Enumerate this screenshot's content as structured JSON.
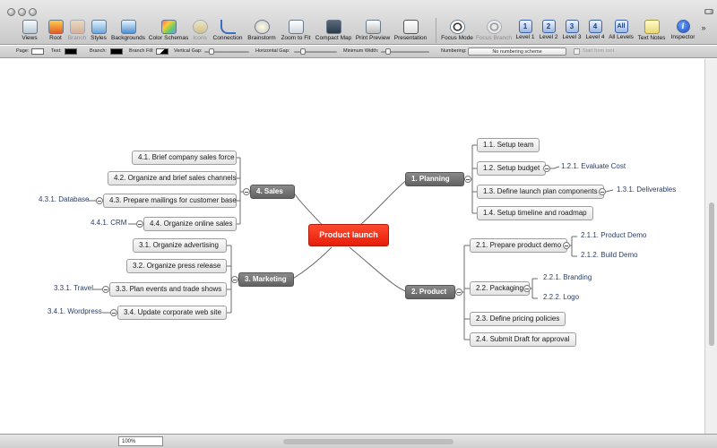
{
  "toolbar": {
    "items": [
      {
        "label": "Views",
        "icon": "views-icon"
      },
      {
        "label": "Root",
        "icon": "root-icon"
      },
      {
        "label": "Branch",
        "icon": "branch-icon",
        "disabled": true
      },
      {
        "label": "Styles",
        "icon": "styles-icon"
      },
      {
        "label": "Backgrounds",
        "icon": "backgrounds-icon"
      },
      {
        "label": "Color Schemas",
        "icon": "color-schemas-icon"
      },
      {
        "label": "Icons",
        "icon": "icons-icon",
        "disabled": true
      },
      {
        "label": "Connection",
        "icon": "connection-icon"
      },
      {
        "label": "Brainstorm",
        "icon": "brainstorm-icon"
      },
      {
        "label": "Zoom to Fit",
        "icon": "zoom-to-fit-icon"
      },
      {
        "label": "Compact Map",
        "icon": "compact-map-icon"
      },
      {
        "label": "Print Preview",
        "icon": "print-preview-icon"
      },
      {
        "label": "Presentation",
        "icon": "presentation-icon"
      },
      {
        "label": "Focus Mode",
        "icon": "focus-mode-icon"
      },
      {
        "label": "Focus Branch",
        "icon": "focus-branch-icon",
        "disabled": true
      },
      {
        "label": "Level 1",
        "icon": "level-1-icon",
        "glyph": "1"
      },
      {
        "label": "Level 2",
        "icon": "level-2-icon",
        "glyph": "2"
      },
      {
        "label": "Level 3",
        "icon": "level-3-icon",
        "glyph": "3"
      },
      {
        "label": "Level 4",
        "icon": "level-4-icon",
        "glyph": "4"
      },
      {
        "label": "All Levels",
        "icon": "all-levels-icon",
        "glyph": "All"
      },
      {
        "label": "Text Notes",
        "icon": "text-notes-icon"
      },
      {
        "label": "Inspector",
        "icon": "inspector-icon",
        "glyph": "i"
      }
    ],
    "overflow": "»"
  },
  "formatbar": {
    "page_label": "Page:",
    "text_label": "Text:",
    "branch_label": "Branch:",
    "branch_fill_label": "Branch Fill:",
    "vertical_gap_label": "Vertical Gap:",
    "horizontal_gap_label": "Horizontal Gap:",
    "minimum_width_label": "Minimum Width:",
    "numbering_label": "Numbering:",
    "numbering_value": "No numbering scheme",
    "start_from_root_label": "Start from root"
  },
  "map": {
    "central": "Product launch",
    "branches": {
      "planning": "1.    Planning",
      "product": "2.    Product",
      "marketing": "3.    Marketing",
      "sales": "4.    Sales"
    },
    "topics": {
      "t1_1": "1.1.   Setup team",
      "t1_2": "1.2.   Setup budget",
      "t1_3": "1.3.   Define launch plan components",
      "t1_4": "1.4.   Setup timeline and roadmap",
      "t2_1": "2.1.   Prepare product demo",
      "t2_2": "2.2.   Packaging",
      "t2_3": "2.3.   Define pricing policies",
      "t2_4": "2.4.   Submit Draft for approval",
      "t3_1": "3.1.   Organize advertising",
      "t3_2": "3.2.   Organize press release",
      "t3_3": "3.3.   Plan events and trade shows",
      "t3_4": "3.4.   Update corporate web site",
      "t4_1": "4.1.   Brief company sales force",
      "t4_2": "4.2.   Organize and brief sales channels",
      "t4_3": "4.3.   Prepare mailings for customer base",
      "t4_4": "4.4.   Organize online sales"
    },
    "subtopics": {
      "s1_2_1": "1.2.1.  Evaluate Cost",
      "s1_3_1": "1.3.1.  Deliverables",
      "s2_1_1": "2.1.1.  Product Demo",
      "s2_1_2": "2.1.2.  Build Demo",
      "s2_2_1": "2.2.1.  Branding",
      "s2_2_2": "2.2.2.  Logo",
      "s3_3_1": "3.3.1.  Travel",
      "s3_4_1": "3.4.1.  Wordpress",
      "s4_3_1": "4.3.1.  Database",
      "s4_4_1": "4.4.1.  CRM"
    }
  },
  "statusbar": {
    "zoom": "100%"
  },
  "colors": {
    "central": "#e8240f",
    "branch": "#6e6e6e",
    "subtopic_text": "#2a3d66"
  }
}
